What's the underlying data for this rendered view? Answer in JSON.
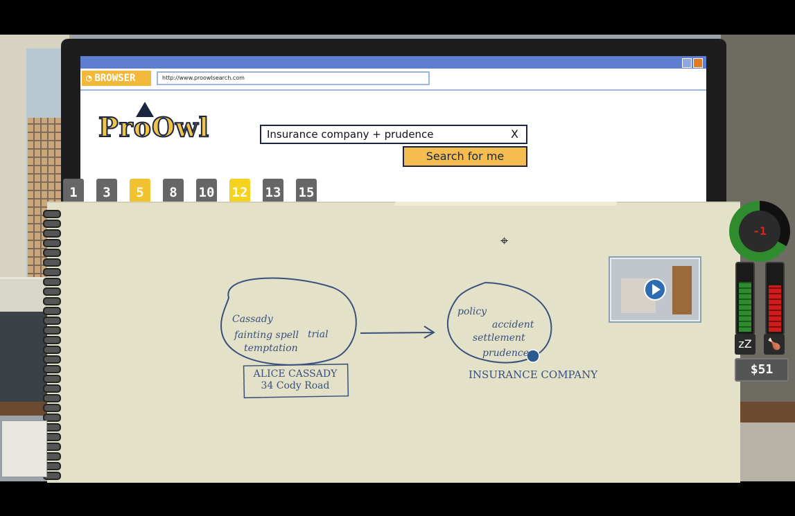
{
  "browser": {
    "title": "BROWSER",
    "url": "http://www.proowlsearch.com",
    "logo_text": "ProOwl"
  },
  "search": {
    "query": "Insurance company + prudence",
    "clear_label": "X",
    "button_label": "Search for me"
  },
  "tabs": [
    {
      "label": "1",
      "state": "grey"
    },
    {
      "label": "3",
      "state": "grey"
    },
    {
      "label": "5",
      "state": "yellow"
    },
    {
      "label": "8",
      "state": "grey"
    },
    {
      "label": "10",
      "state": "grey"
    },
    {
      "label": "12",
      "state": "active"
    },
    {
      "label": "13",
      "state": "grey"
    },
    {
      "label": "15",
      "state": "grey"
    }
  ],
  "mindmap": {
    "left_bubble_words": [
      "Cassady",
      "fainting spell",
      "trial",
      "temptation"
    ],
    "left_card": {
      "name": "ALICE CASSADY",
      "address": "34 Cody Road"
    },
    "right_bubble_words": [
      "policy",
      "accident",
      "settlement",
      "prudence"
    ],
    "right_label": "INSURANCE COMPANY"
  },
  "hud": {
    "clock_value": "-1",
    "clock_level": 0.67,
    "energy_level": 0.75,
    "hunger_level": 0.7,
    "money": "$51",
    "colors": {
      "energy": "#2e8b2e",
      "hunger": "#d11a1a",
      "accent": "#f5bd4f",
      "titlebar": "#5e7fd1"
    },
    "icons": {
      "sleep": "sleep-icon",
      "food": "food-icon"
    }
  }
}
